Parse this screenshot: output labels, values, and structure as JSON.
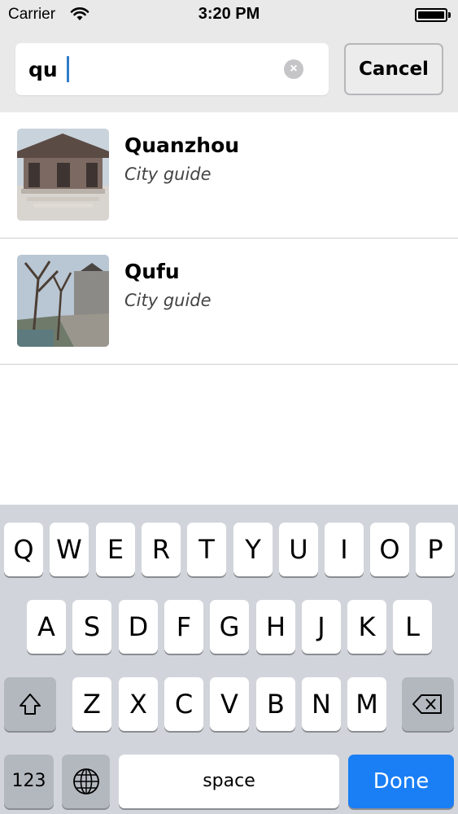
{
  "status_bar": {
    "carrier": "Carrier",
    "time": "3:20 PM"
  },
  "search": {
    "query": "qu",
    "cancel_label": "Cancel"
  },
  "results": [
    {
      "title": "Quanzhou",
      "subtitle": "City guide",
      "thumbnail_icon": "temple-photo"
    },
    {
      "title": "Qufu",
      "subtitle": "City guide",
      "thumbnail_icon": "riverside-photo"
    }
  ],
  "keyboard": {
    "row1": [
      "Q",
      "W",
      "E",
      "R",
      "T",
      "Y",
      "U",
      "I",
      "O",
      "P"
    ],
    "row2": [
      "A",
      "S",
      "D",
      "F",
      "G",
      "H",
      "J",
      "K",
      "L"
    ],
    "row3": [
      "Z",
      "X",
      "C",
      "V",
      "B",
      "N",
      "M"
    ],
    "numbers_label": "123",
    "space_label": "space",
    "done_label": "Done"
  },
  "colors": {
    "accent": "#1a7ef5",
    "caret": "#2f7dc8",
    "keyboard_bg": "#d1d5db"
  }
}
